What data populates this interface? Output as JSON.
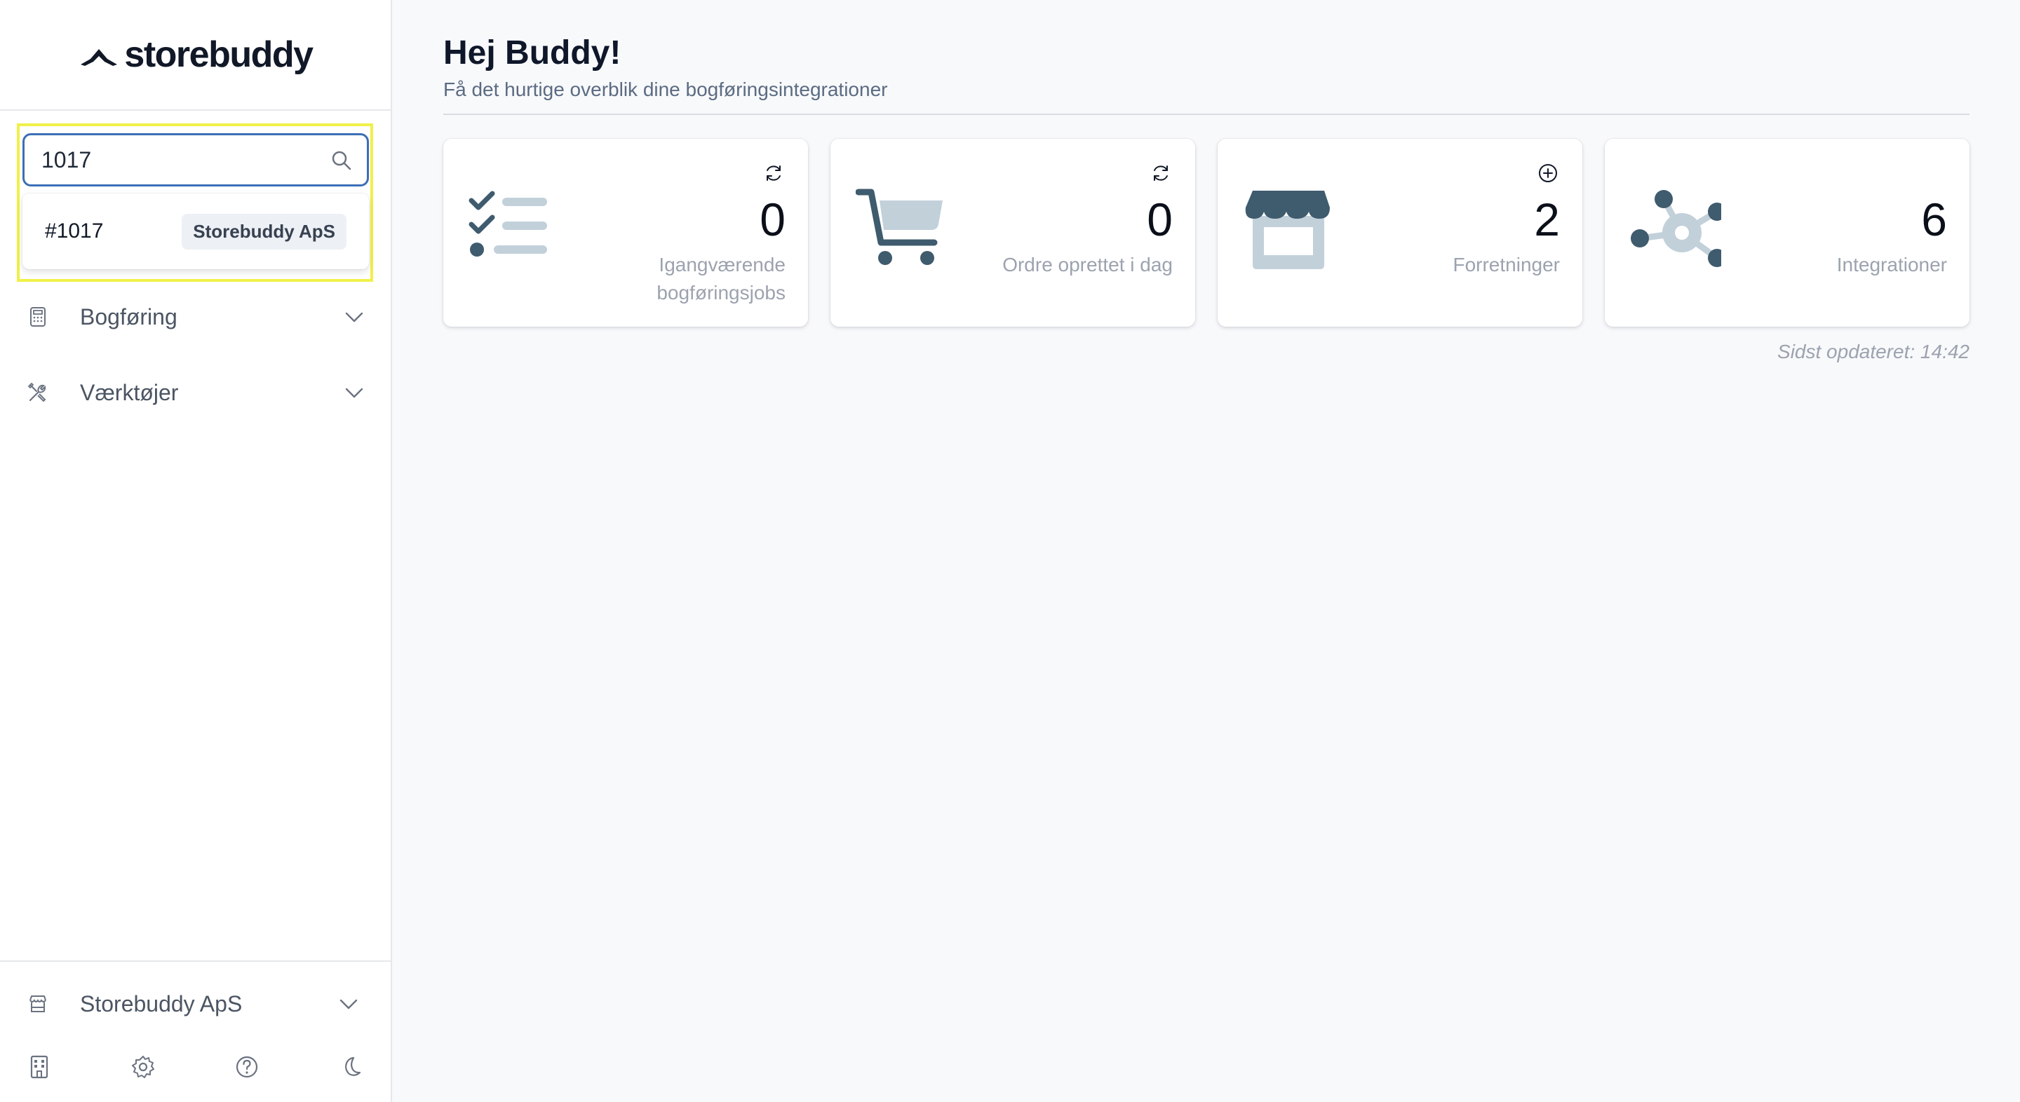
{
  "brand": {
    "name": "storebuddy"
  },
  "search": {
    "value": "1017",
    "results": [
      {
        "id": "#1017",
        "store": "Storebuddy ApS"
      }
    ]
  },
  "sidebar": {
    "items": [
      {
        "label": "Bogføring",
        "icon": "calculator-icon"
      },
      {
        "label": "Værktøjer",
        "icon": "tools-icon"
      }
    ],
    "store_switch": {
      "label": "Storebuddy ApS",
      "icon": "store-icon"
    },
    "bottom_icons": [
      "building-icon",
      "gear-icon",
      "help-icon",
      "moon-icon"
    ]
  },
  "header": {
    "greeting": "Hej Buddy!",
    "subtitle": "Få det hurtige overblik dine bogføringsintegrationer"
  },
  "cards": [
    {
      "value": "0",
      "label": "Igangværende bogføringsjobs",
      "action_icon": "refresh-icon",
      "illustration": "checklist-icon"
    },
    {
      "value": "0",
      "label": "Ordre oprettet i dag",
      "action_icon": "refresh-icon",
      "illustration": "cart-icon"
    },
    {
      "value": "2",
      "label": "Forretninger",
      "action_icon": "plus-circle-icon",
      "illustration": "storefront-icon"
    },
    {
      "value": "6",
      "label": "Integrationer",
      "action_icon": "",
      "illustration": "network-icon"
    }
  ],
  "last_updated": "Sidst opdateret: 14:42",
  "colors": {
    "accent_dark": "#3f5b6e",
    "accent_light": "#c2d0da",
    "focus_border": "#3b6fb6",
    "highlight": "#f0f04a"
  }
}
